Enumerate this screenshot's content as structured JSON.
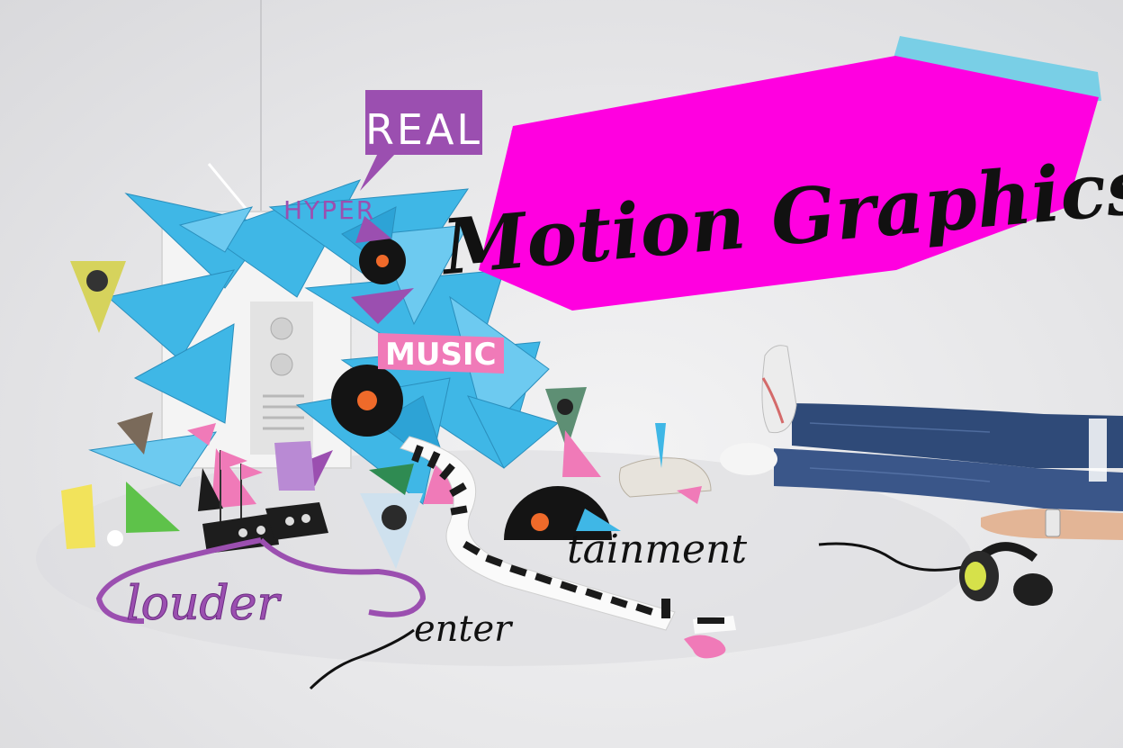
{
  "banner": {
    "title": "Motion Graphics",
    "fill": "#ff00e0",
    "shadow": "#79cfe6",
    "text_color": "#111111"
  },
  "sculpture": {
    "bubble_real": "REAL",
    "label_hyper": "HYPER",
    "label_music": "MUSIC",
    "ribbon_louder": "louder",
    "cable_enter": "enter",
    "cable_tainment": "tainment"
  },
  "colors": {
    "crystal": "#3fb7e6",
    "purple": "#9b4fb0",
    "pink": "#f07ab8",
    "green": "#5ec24a",
    "yellow": "#f2e35b",
    "denim": "#2f4a78"
  }
}
